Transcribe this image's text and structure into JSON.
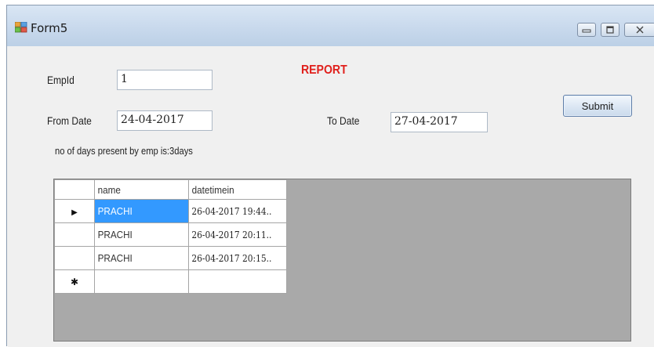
{
  "window": {
    "title": "Form5",
    "icon": "form-app-icon",
    "controls": [
      "minimize-icon",
      "maximize-icon",
      "close-icon"
    ]
  },
  "form": {
    "report_title": "REPORT",
    "empid_label": "EmpId",
    "empid_value": "1",
    "from_date_label": "From Date",
    "from_date_value": "24-04-2017",
    "to_date_label": "To Date",
    "to_date_value": "27-04-2017",
    "submit_label": "Submit",
    "days_present_text": "no of days present by emp is:3days"
  },
  "grid": {
    "columns": [
      "name",
      "datetimein"
    ],
    "rows": [
      {
        "name": "PRACHI",
        "datetimein": "26-04-2017 19:44..",
        "selected": true
      },
      {
        "name": "PRACHI",
        "datetimein": "26-04-2017 20:11..",
        "selected": false
      },
      {
        "name": "PRACHI",
        "datetimein": "26-04-2017 20:15..",
        "selected": false
      }
    ],
    "new_row_marker": "✱",
    "current_row_marker": "▶"
  },
  "colors": {
    "report_title": "#e0201c",
    "selection": "#3399ff",
    "grid_background": "#a9a9a9"
  }
}
